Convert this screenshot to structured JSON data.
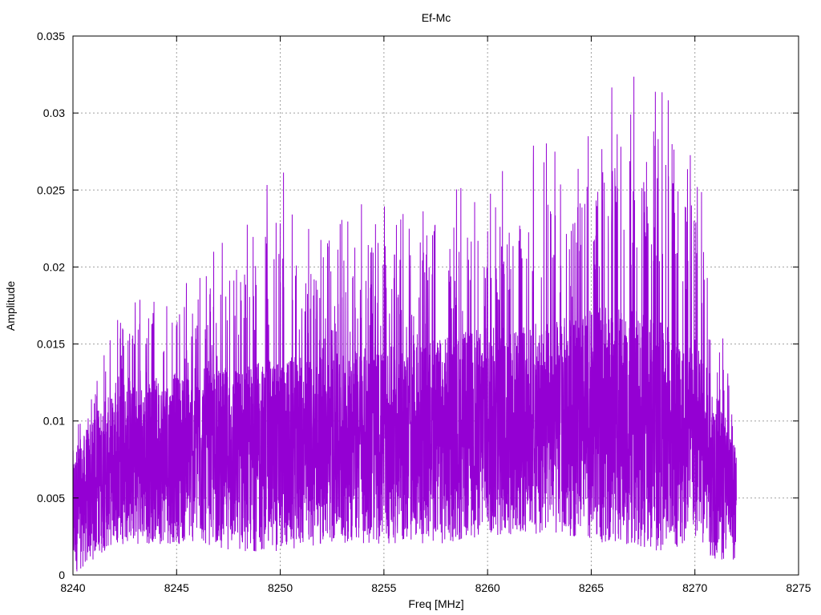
{
  "chart_data": {
    "type": "line",
    "title": "Ef-Mc",
    "xlabel": "Freq [MHz]",
    "ylabel": "Amplitude",
    "xlim": [
      8240,
      8275
    ],
    "ylim": [
      0,
      0.035
    ],
    "grid": true,
    "x_ticks": [
      "8240",
      "8245",
      "8250",
      "8255",
      "8260",
      "8265",
      "8270",
      "8275"
    ],
    "y_ticks": [
      "0",
      "0.005",
      "0.01",
      "0.015",
      "0.02",
      "0.025",
      "0.03",
      "0.035"
    ],
    "series_color": "#9400d3",
    "series": [
      {
        "name": "",
        "x_range": [
          8240,
          8272
        ],
        "envelope_x": [
          8240,
          8242,
          8244,
          8246,
          8248,
          8250,
          8252,
          8254,
          8256,
          8258,
          8260,
          8262,
          8264,
          8266,
          8268,
          8270,
          8271,
          8272
        ],
        "envelope_max": [
          0.009,
          0.0175,
          0.02,
          0.02,
          0.024,
          0.028,
          0.022,
          0.0263,
          0.0235,
          0.025,
          0.026,
          0.0285,
          0.028,
          0.0318,
          0.033,
          0.0282,
          0.0205,
          0.0085
        ],
        "envelope_typical": [
          0.006,
          0.009,
          0.0095,
          0.01,
          0.01,
          0.0105,
          0.0105,
          0.011,
          0.011,
          0.0115,
          0.012,
          0.012,
          0.0125,
          0.013,
          0.0125,
          0.0115,
          0.009,
          0.006
        ],
        "envelope_min": [
          0.0,
          0.002,
          0.002,
          0.002,
          0.0015,
          0.0015,
          0.002,
          0.002,
          0.002,
          0.002,
          0.0025,
          0.0025,
          0.0025,
          0.002,
          0.0015,
          0.002,
          0.001,
          0.001
        ]
      }
    ]
  }
}
